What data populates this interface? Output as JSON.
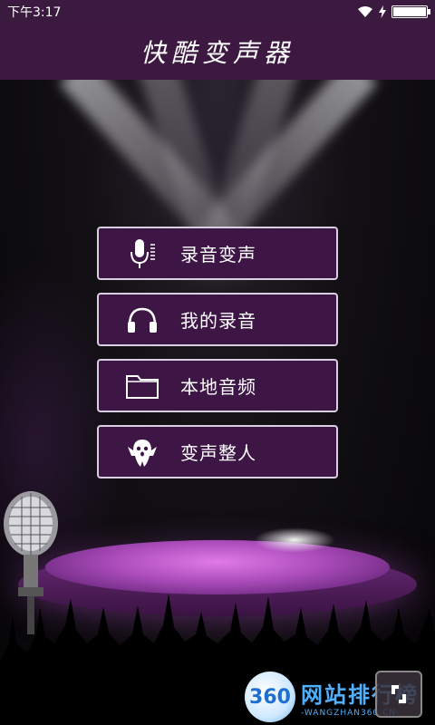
{
  "status_bar": {
    "time": "下午3:17",
    "battery_level": 1.0
  },
  "header": {
    "title": "快酷变声器"
  },
  "menu": {
    "items": [
      {
        "label": "录音变声",
        "icon": "microphone-icon"
      },
      {
        "label": "我的录音",
        "icon": "headphones-icon"
      },
      {
        "label": "本地音频",
        "icon": "folder-icon"
      },
      {
        "label": "变声整人",
        "icon": "ghost-icon"
      }
    ]
  },
  "watermark": {
    "badge": "360",
    "text": "网站排行榜",
    "sub": "-WANGZHAN360.CN-"
  },
  "colors": {
    "header_bg": "#3d1840",
    "button_bg": "#3e1646",
    "button_border": "#d9cfe0",
    "platform": "#b04ec0"
  }
}
